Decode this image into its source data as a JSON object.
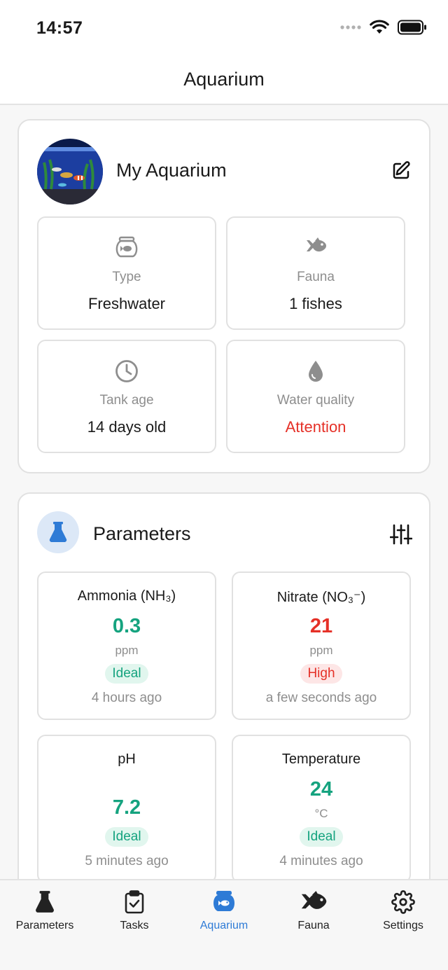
{
  "status_bar": {
    "time": "14:57"
  },
  "nav": {
    "title": "Aquarium"
  },
  "aquarium_card": {
    "name": "My Aquarium",
    "tiles": [
      {
        "icon": "fishbowl-icon",
        "label": "Type",
        "value": "Freshwater"
      },
      {
        "icon": "fish-icon",
        "label": "Fauna",
        "value": "1 fishes"
      },
      {
        "icon": "clock-icon",
        "label": "Tank age",
        "value": "14 days old"
      },
      {
        "icon": "water-drop-icon",
        "label": "Water quality",
        "value": "Attention"
      }
    ]
  },
  "parameters_card": {
    "title": "Parameters",
    "items": [
      {
        "name": "Ammonia (NH₃)",
        "value": "0.3",
        "unit": "ppm",
        "status": "Ideal",
        "updated": "4 hours ago"
      },
      {
        "name": "Nitrate (NO₃⁻)",
        "value": "21",
        "unit": "ppm",
        "status": "High",
        "updated": "a few seconds ago"
      },
      {
        "name": "pH",
        "value": "7.2",
        "unit": "",
        "status": "Ideal",
        "updated": "5 minutes ago"
      },
      {
        "name": "Temperature",
        "value": "24",
        "unit": "°C",
        "status": "Ideal",
        "updated": "4 minutes ago"
      }
    ]
  },
  "tab_bar": {
    "tabs": [
      {
        "label": "Parameters",
        "icon": "flask-icon"
      },
      {
        "label": "Tasks",
        "icon": "clipboard-check-icon"
      },
      {
        "label": "Aquarium",
        "icon": "fishbowl-icon"
      },
      {
        "label": "Fauna",
        "icon": "fish-icon"
      },
      {
        "label": "Settings",
        "icon": "gear-icon"
      }
    ],
    "active": "Aquarium"
  },
  "colors": {
    "accent": "#2e7bd6",
    "ideal": "#15a37f",
    "alert": "#e53027"
  }
}
